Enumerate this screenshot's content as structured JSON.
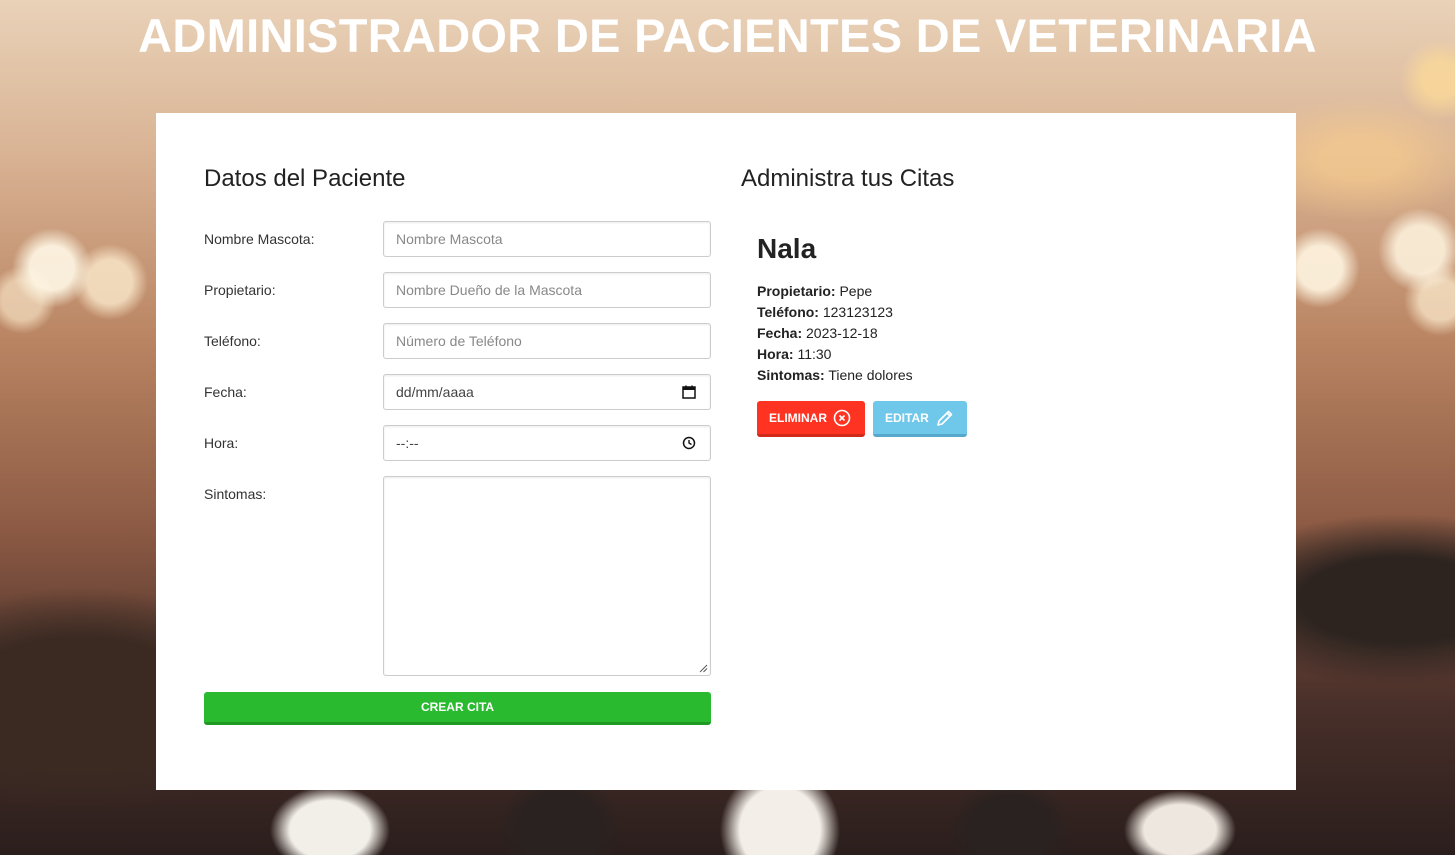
{
  "header": {
    "title": "ADMINISTRADOR DE PACIENTES DE VETERINARIA"
  },
  "form": {
    "title": "Datos del Paciente",
    "fields": [
      {
        "label": "Nombre Mascota:",
        "placeholder": "Nombre Mascota"
      },
      {
        "label": "Propietario:",
        "placeholder": "Nombre Dueño de la Mascota"
      },
      {
        "label": "Teléfono:",
        "placeholder": "Número de Teléfono"
      },
      {
        "label": "Fecha:",
        "placeholder": "dd/mm/aaaa",
        "icon": "calendar-icon"
      },
      {
        "label": "Hora:",
        "placeholder": "--:--",
        "icon": "clock-icon"
      },
      {
        "label": "Sintomas:",
        "placeholder": ""
      }
    ],
    "submit_label": "CREAR CITA"
  },
  "appointments": {
    "title": "Administra tus Citas",
    "items": [
      {
        "pet_name": "Nala",
        "owner_label": "Propietario:",
        "owner": "Pepe",
        "phone_label": "Teléfono:",
        "phone": "123123123",
        "date_label": "Fecha:",
        "date": "2023-12-18",
        "time_label": "Hora:",
        "time": "11:30",
        "symptoms_label": "Sintomas:",
        "symptoms": "Tiene dolores",
        "delete_label": "ELIMINAR",
        "edit_label": "EDITAR"
      }
    ]
  },
  "colors": {
    "create_button": "#2aba2f",
    "delete_button": "#ff3322",
    "edit_button": "#6fc7ea",
    "panel": "#ffffff"
  }
}
